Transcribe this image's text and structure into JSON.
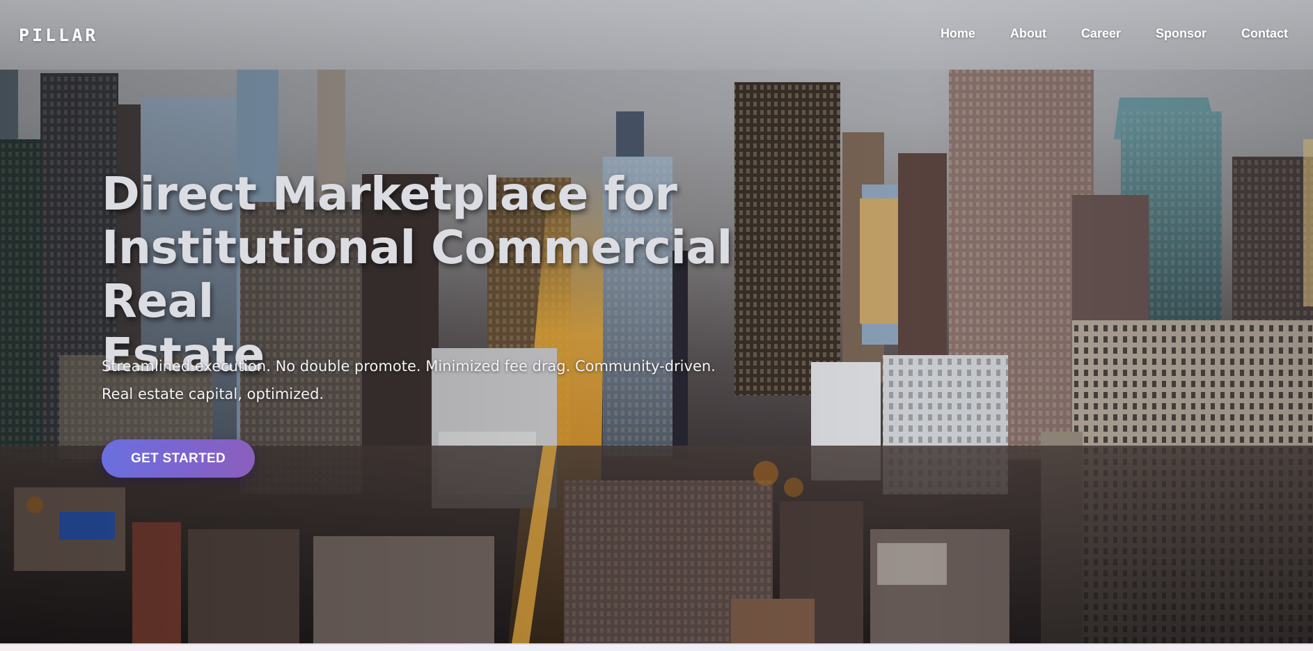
{
  "header": {
    "logo": "PILLAR",
    "nav": [
      {
        "label": "Home"
      },
      {
        "label": "About"
      },
      {
        "label": "Career"
      },
      {
        "label": "Sponsor"
      },
      {
        "label": "Contact"
      }
    ]
  },
  "hero": {
    "headline_line1": "Direct Marketplace for",
    "headline_line2": "Institutional Commercial Real",
    "headline_line3": "Estate",
    "subtext_line1": "Streamlined execution. No double promote. Minimized fee drag. Community-driven.",
    "subtext_line2": "Real estate capital, optimized.",
    "cta_label": "GET STARTED",
    "cta_gradient": [
      "#6a6fe0",
      "#8b5fbd"
    ],
    "background": "city-skyline-photo"
  }
}
